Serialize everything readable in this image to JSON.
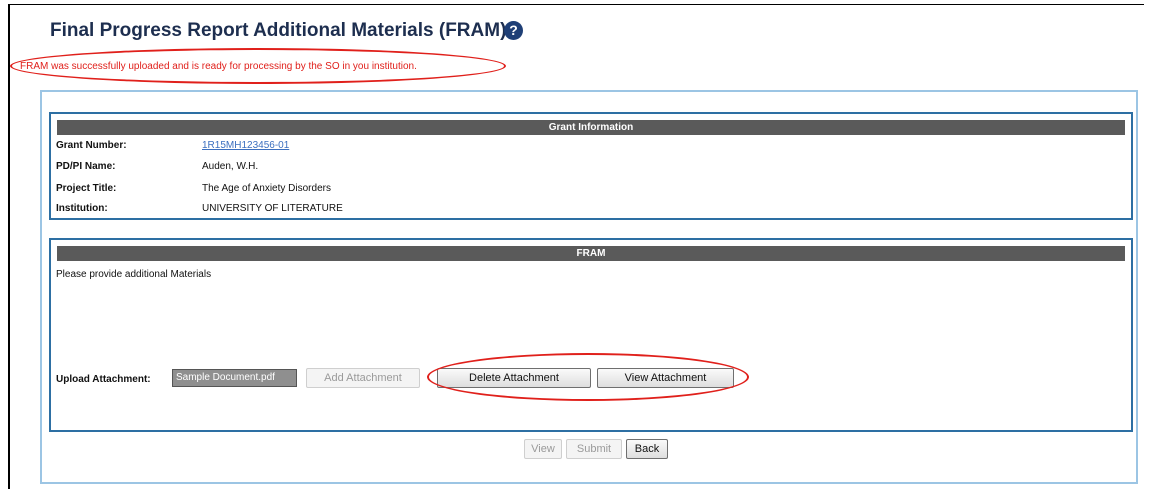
{
  "page": {
    "title": "Final Progress Report Additional Materials (FRAM)",
    "help_icon": "question-circle-icon",
    "success_message": "FRAM was successfully uploaded and is ready for processing by the SO in you institution."
  },
  "grant_info": {
    "header": "Grant Information",
    "rows": [
      {
        "label": "Grant Number:",
        "value": "1R15MH123456-01"
      },
      {
        "label": "PD/PI Name:",
        "value": "Auden, W.H."
      },
      {
        "label": "Project Title:",
        "value": "The Age of Anxiety Disorders"
      },
      {
        "label": "Institution:",
        "value": "UNIVERSITY OF LITERATURE"
      }
    ]
  },
  "fram": {
    "header": "FRAM",
    "prompt": "Please provide additional Materials",
    "upload_label": "Upload Attachment:",
    "file_name": "Sample Document.pdf",
    "add_attachment": "Add Attachment",
    "delete_attachment": "Delete Attachment",
    "view_attachment": "View Attachment"
  },
  "footer": {
    "view": "View",
    "submit": "Submit",
    "back": "Back"
  },
  "colors": {
    "highlight": "#e0201b",
    "panel_border": "#2d6fa3",
    "outer_box_border": "#9cc5e4",
    "header_bar": "#5a5a5a",
    "link": "#3b6fbf"
  }
}
